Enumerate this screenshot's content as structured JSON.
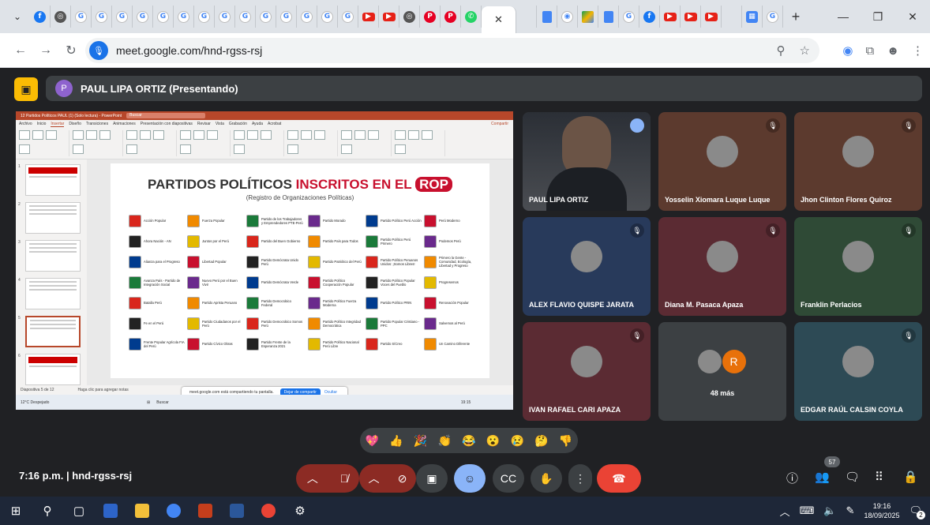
{
  "browser": {
    "tabs_favicons": [
      "chevron-down",
      "facebook",
      "openai",
      "google",
      "google",
      "google",
      "google",
      "google",
      "google",
      "google",
      "google",
      "google",
      "google",
      "google",
      "google",
      "google",
      "google",
      "youtube",
      "youtube",
      "openai",
      "pinterest",
      "pinterest",
      "whatsapp"
    ],
    "tabs_after_active": [
      "meet",
      "docs",
      "chrome",
      "drive",
      "docs",
      "google",
      "facebook",
      "youtube",
      "youtube",
      "youtube",
      "meet",
      "calendar",
      "google"
    ],
    "new_tab": "+",
    "url": "meet.google.com/hnd-rgss-rsj"
  },
  "meet": {
    "presenter_initial": "P",
    "presenter_banner": "PAUL LIPA ORTIZ (Presentando)",
    "meeting_time": "7:16 p.m.",
    "separator": "|",
    "meeting_code": "hnd-rgss-rsj",
    "participants_count": "57",
    "reactions": [
      "💖",
      "👍",
      "🎉",
      "👏",
      "😂",
      "😮",
      "😢",
      "🤔",
      "👎"
    ]
  },
  "participants": [
    {
      "name": "PAUL LIPA ORTIZ",
      "video": true,
      "speaking": true,
      "color": "#3c4043"
    },
    {
      "name": "Yosselin Xiomara Luque Luque",
      "muted": true,
      "color": "#5c3a2e"
    },
    {
      "name": "Jhon Clinton Flores Quiroz",
      "muted": true,
      "color": "#5c3a2e"
    },
    {
      "name": "ALEX FLAVIO QUISPE JARATA",
      "muted": true,
      "color": "#283a5b"
    },
    {
      "name": "Diana M. Pasaca Apaza",
      "muted": true,
      "color": "#5b2b33"
    },
    {
      "name": "Franklin Perlacios",
      "muted": true,
      "color": "#2f4a36"
    },
    {
      "name": "IVAN RAFAEL CARI APAZA",
      "muted": true,
      "color": "#5b2b33"
    },
    {
      "name": "48 más",
      "others_initial": "R",
      "color": "#3c4043"
    },
    {
      "name": "EDGAR RAÚL CALSIN COYLA",
      "muted": true,
      "color": "#2d4a55"
    }
  ],
  "powerpoint": {
    "window_title": "12 Partidos Políticos PAUL (1) (Solo lectura) - PowerPoint",
    "search": "Buscar",
    "menu": [
      "Archivo",
      "Inicio",
      "Insertar",
      "Diseño",
      "Transiciones",
      "Animaciones",
      "Presentación con diapositivas",
      "Revisar",
      "Vista",
      "Grabación",
      "Ayuda",
      "Acrobat"
    ],
    "share": "Compartir",
    "slide_title_part1": "PARTIDOS POLÍTICOS ",
    "slide_title_part2": "INSCRITOS EN EL ",
    "slide_title_rop": "ROP",
    "slide_subtitle": "(Registro de Organizaciones Políticas)",
    "notes_placeholder": "Haga clic para agregar notas",
    "status": "Diapositiva 5 de 12",
    "sharing_notice": "meet.google.com está compartiendo tu pantalla.",
    "stop_sharing": "Dejar de compartir",
    "hide": "Ocultar",
    "taskbar_search": "Buscar",
    "taskbar_clock": "19:15",
    "weather": "12°C Despejado",
    "parties": [
      [
        "Acción Popular",
        "Fuerza Popular",
        "Partido de los Trabajadores y Emprendedores PTE-Perú",
        "Partido Morado",
        "Partido Político Perú Acción",
        "Perú Moderno"
      ],
      [
        "Ahora Nación - AN",
        "Juntos por el Perú",
        "Partido del Buen Gobierno",
        "Partido País para Todos",
        "Partido Político Perú Primero",
        "Podemos Perú"
      ],
      [
        "Alianza para el Progreso",
        "Libertad Popular",
        "Partido Demócrata Unido Perú",
        "Partido Patriótico del Perú",
        "Partido Político Peruanos Unidos: ¡Somos Libres!",
        "Primero la Gente - Comunidad, Ecología, Libertad y Progreso"
      ],
      [
        "Avanza País - Partido de Integración Social",
        "Nuevo Perú por el Buen Vivir",
        "Partido Demócrata Verde",
        "Partido Político Cooperación Popular",
        "Partido Político Popular Voces del Pueblo",
        "Progresemos"
      ],
      [
        "Batalla Perú",
        "Partido Aprista Peruano",
        "Partido Democrático Federal",
        "Partido Político Fuerza Moderna",
        "Partido Político PRIN",
        "Renovación Popular"
      ],
      [
        "Fe en el Perú",
        "Partido Ciudadanos por el Perú",
        "Partido Democrático Somos Perú",
        "Partido Político Integridad Democrática",
        "Partido Popular Cristiano - PPC",
        "Salvemos al Perú"
      ],
      [
        "Frente Popular Agrícola FIA del Perú",
        "Partido Cívico Obras",
        "Partido Frente de la Esperanza 2021",
        "Partido Político Nacional Perú Libre",
        "Partido SíCreo",
        "Un Camino Diferente"
      ]
    ],
    "party_colors": [
      "#d9261c",
      "#f08a00",
      "#1b7a3a",
      "#6a2a8c",
      "#003b8e",
      "#c8102e",
      "#222222",
      "#e3b900"
    ]
  },
  "system": {
    "time": "19:16",
    "date": "18/09/2025",
    "notifications": "2"
  }
}
